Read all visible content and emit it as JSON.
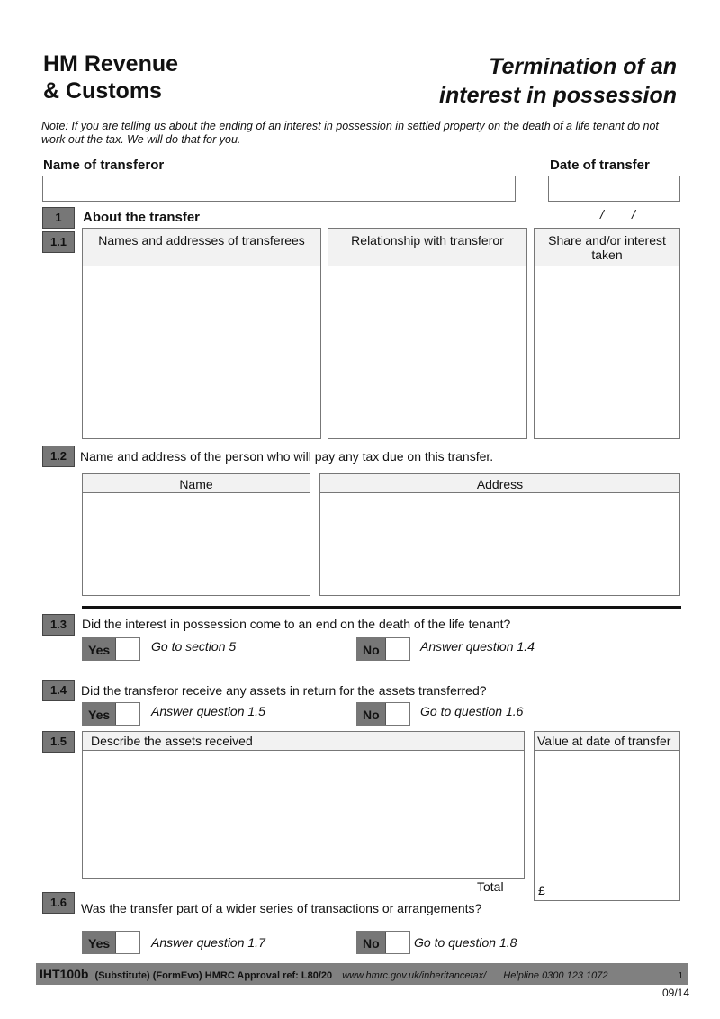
{
  "header": {
    "org_line1": "HM Revenue",
    "org_line2": "& Customs",
    "title_line1": "Termination of an",
    "title_line2": "interest in possession"
  },
  "note": "Note: If you are telling us about the ending of an interest in possession in settled property on the death of a life tenant do not work out the tax.  We will do that for you.",
  "transferor": {
    "name_label": "Name of transferor",
    "name_value": "",
    "date_label": "Date of transfer",
    "date_sep": "/        /"
  },
  "section1": {
    "number": "1",
    "title": "About the transfer"
  },
  "q1_1": {
    "number": "1.1",
    "columns": [
      "Names and addresses of transferees",
      "Relationship with transferor",
      "Share and/or interest taken"
    ]
  },
  "q1_2": {
    "number": "1.2",
    "text": "Name and address of the person who will pay any tax due on this transfer.",
    "columns": [
      "Name",
      "Address"
    ]
  },
  "q1_3": {
    "number": "1.3",
    "text": "Did the interest in possession come to an end on the death of the life tenant?",
    "yes_label": "Yes",
    "yes_instr": "Go to section 5",
    "no_label": "No",
    "no_instr": "Answer question 1.4"
  },
  "q1_4": {
    "number": "1.4",
    "text": "Did the transferor receive any assets in return for the assets transferred?",
    "yes_label": "Yes",
    "yes_instr": "Answer question 1.5",
    "no_label": "No",
    "no_instr": "Go to question 1.6"
  },
  "q1_5": {
    "number": "1.5",
    "describe_header": "Describe the assets received",
    "value_header": "Value at date of transfer",
    "total_label": "Total",
    "currency": "£"
  },
  "q1_6": {
    "number": "1.6",
    "text": "Was the transfer part of a wider series of transactions or arrangements?",
    "yes_label": "Yes",
    "yes_instr": "Answer question 1.7",
    "no_label": "No",
    "no_instr": "Go to question 1.8"
  },
  "footer": {
    "form_code": "IHT100b",
    "approval": "(Substitute) (FormEvo) HMRC Approval ref: L80/20",
    "url": "www.hmrc.gov.uk/inheritancetax/",
    "helpline": "Helpline 0300 123 1072",
    "page": "1",
    "version": "09/14"
  }
}
